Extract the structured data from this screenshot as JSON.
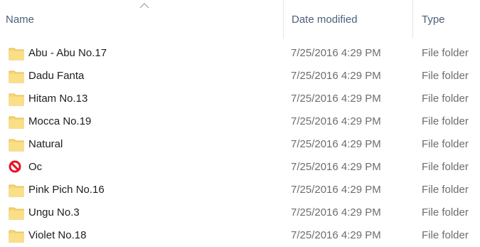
{
  "header": {
    "name_label": "Name",
    "date_label": "Date modified",
    "type_label": "Type",
    "sorted_column": "name",
    "sort_direction": "ascending"
  },
  "colors": {
    "header_text": "#4c607a",
    "row_text": "#1e1e1e",
    "secondary_text": "#6d6d6d",
    "folder": "#f8d775",
    "folder_shade": "#e0b84a",
    "blocked": "#e81123"
  },
  "rows": [
    {
      "name": "Abu - Abu No.17",
      "date": "7/25/2016 4:29 PM",
      "type": "File folder",
      "icon": "folder-icon"
    },
    {
      "name": "Dadu Fanta",
      "date": "7/25/2016 4:29 PM",
      "type": "File folder",
      "icon": "folder-icon"
    },
    {
      "name": "Hitam No.13",
      "date": "7/25/2016 4:29 PM",
      "type": "File folder",
      "icon": "folder-icon"
    },
    {
      "name": "Mocca No.19",
      "date": "7/25/2016 4:29 PM",
      "type": "File folder",
      "icon": "folder-icon"
    },
    {
      "name": "Natural",
      "date": "7/25/2016 4:29 PM",
      "type": "File folder",
      "icon": "folder-icon"
    },
    {
      "name": "Oc",
      "date": "7/25/2016 4:29 PM",
      "type": "File folder",
      "icon": "blocked-icon"
    },
    {
      "name": "Pink Pich No.16",
      "date": "7/25/2016 4:29 PM",
      "type": "File folder",
      "icon": "folder-icon"
    },
    {
      "name": "Ungu No.3",
      "date": "7/25/2016 4:29 PM",
      "type": "File folder",
      "icon": "folder-icon"
    },
    {
      "name": "Violet No.18",
      "date": "7/25/2016 4:29 PM",
      "type": "File folder",
      "icon": "folder-icon"
    }
  ]
}
